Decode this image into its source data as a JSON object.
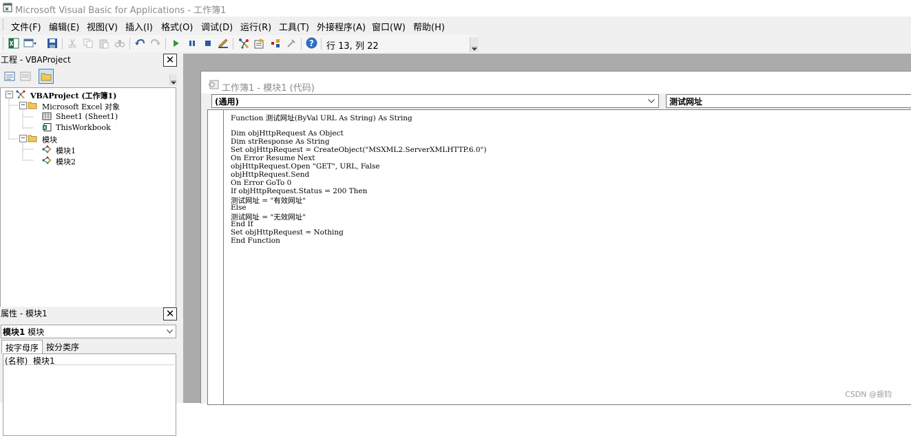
{
  "window": {
    "title": "Microsoft Visual Basic for Applications - 工作簿1"
  },
  "menu": [
    "文件(F)",
    "编辑(E)",
    "视图(V)",
    "插入(I)",
    "格式(O)",
    "调试(D)",
    "运行(R)",
    "工具(T)",
    "外接程序(A)",
    "窗口(W)",
    "帮助(H)"
  ],
  "toolbar": {
    "position": "行 13, 列 22",
    "icons": [
      "excel-icon",
      "insert-userform-icon",
      "save-icon",
      "cut-icon",
      "copy-icon",
      "paste-icon",
      "find-icon",
      "undo-icon",
      "redo-icon",
      "run-icon",
      "break-icon",
      "reset-icon",
      "design-mode-icon",
      "project-explorer-icon",
      "properties-icon",
      "object-browser-icon",
      "toolbox-icon",
      "help-icon"
    ]
  },
  "project": {
    "title": "工程 - VBAProject",
    "tree": [
      {
        "label": "VBAProject (工作簿1)"
      },
      {
        "label": "Microsoft Excel 对象"
      },
      {
        "label": "Sheet1 (Sheet1)"
      },
      {
        "label": "ThisWorkbook"
      },
      {
        "label": "模块"
      },
      {
        "label": "模块1"
      },
      {
        "label": "模块2"
      }
    ]
  },
  "properties": {
    "title": "属性 - 模块1",
    "object_name": "模块1",
    "object_type": "模块",
    "tabs": [
      "按字母序",
      "按分类序"
    ],
    "rows": [
      {
        "name": "(名称)",
        "value": "模块1"
      }
    ]
  },
  "code_window": {
    "title": "工作簿1 - 模块1 (代码)",
    "object_combo": "(通用)",
    "procedure_combo": "测试网址",
    "lines": [
      "Function 测试网址(ByVal URL As String) As String",
      "",
      "Dim objHttpRequest As Object",
      "Dim strResponse As String",
      "Set objHttpRequest = CreateObject(\"MSXML2.ServerXMLHTTP.6.0\")",
      "On Error Resume Next",
      "objHttpRequest.Open \"GET\", URL, False",
      "objHttpRequest.Send",
      "On Error GoTo 0",
      "If objHttpRequest.Status = 200 Then",
      "测试网址 = \"有效网址\"",
      "Else",
      "测试网址 = \"无效网址\"",
      "End If",
      "Set objHttpRequest = Nothing",
      "End Function"
    ]
  },
  "watermark": "CSDN @振钧"
}
